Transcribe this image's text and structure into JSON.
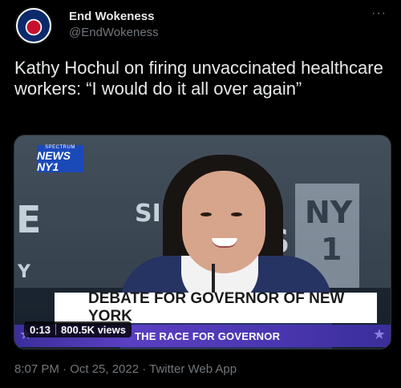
{
  "author": {
    "name": "End Wokeness",
    "handle": "@EndWokeness",
    "avatar_icon": "eagle-flag-badge-icon"
  },
  "menu_icon": "more-horizontal-icon",
  "tweet": {
    "text": "Kathy Hochul on firing unvaccinated healthcare workers: “I would do it all over again”"
  },
  "video": {
    "elapsed": "0:13",
    "views": "800.5K views",
    "broadcast": {
      "network_small": "SPECTRUM",
      "network": "NEWS NY1",
      "headline": "DEBATE FOR GOVERNOR OF NEW YORK",
      "subheadline": "THE RACE FOR GOVERNOR"
    },
    "background_text": {
      "left": "E",
      "center": "SI     M",
      "center2": "/S",
      "right": "NY",
      "right2": "1",
      "small": "Y"
    }
  },
  "meta": {
    "timestamp": "8:07 PM · Oct 25, 2022 · Twitter Web App"
  },
  "colors": {
    "background": "#000000",
    "text_primary": "#e7e9ea",
    "text_secondary": "#71767b",
    "lower_third_band": "#4a36b0",
    "news_logo": "#1b49b8"
  }
}
